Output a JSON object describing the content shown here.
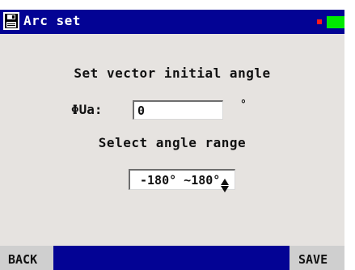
{
  "window": {
    "title": "Arc set",
    "icon": "floppy-disk-icon"
  },
  "status": {
    "indicator_color": "#ff1a1a",
    "battery_color": "#00ea00",
    "battery_icon": "battery-icon"
  },
  "colors": {
    "title_bar": "#030394",
    "panel_background": "#e6e3e0",
    "button_background": "#cfcfcf"
  },
  "form": {
    "heading": "Set vector initial angle",
    "angle_label": "ΦUa:",
    "angle_value": "0",
    "angle_unit": "°",
    "range_heading": "Select angle range",
    "range_selected": "-180° ~180°"
  },
  "footer": {
    "back_label": "BACK",
    "save_label": "SAVE"
  }
}
